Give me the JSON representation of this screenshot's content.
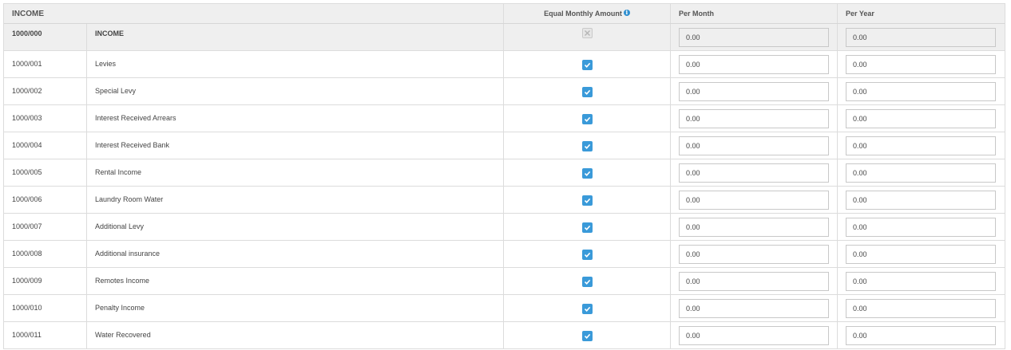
{
  "header": {
    "section": "INCOME",
    "equal_monthly": "Equal Monthly Amount",
    "per_month": "Per Month",
    "per_year": "Per Year"
  },
  "group": {
    "code": "1000/000",
    "name": "INCOME",
    "per_month": "0.00",
    "per_year": "0.00"
  },
  "rows": [
    {
      "code": "1000/001",
      "name": "Levies",
      "equal": true,
      "per_month": "0.00",
      "per_year": "0.00"
    },
    {
      "code": "1000/002",
      "name": "Special Levy",
      "equal": true,
      "per_month": "0.00",
      "per_year": "0.00"
    },
    {
      "code": "1000/003",
      "name": "Interest Received Arrears",
      "equal": true,
      "per_month": "0.00",
      "per_year": "0.00"
    },
    {
      "code": "1000/004",
      "name": "Interest Received Bank",
      "equal": true,
      "per_month": "0.00",
      "per_year": "0.00"
    },
    {
      "code": "1000/005",
      "name": "Rental Income",
      "equal": true,
      "per_month": "0.00",
      "per_year": "0.00"
    },
    {
      "code": "1000/006",
      "name": "Laundry Room Water",
      "equal": true,
      "per_month": "0.00",
      "per_year": "0.00"
    },
    {
      "code": "1000/007",
      "name": "Additional Levy",
      "equal": true,
      "per_month": "0.00",
      "per_year": "0.00"
    },
    {
      "code": "1000/008",
      "name": "Additional insurance",
      "equal": true,
      "per_month": "0.00",
      "per_year": "0.00"
    },
    {
      "code": "1000/009",
      "name": "Remotes Income",
      "equal": true,
      "per_month": "0.00",
      "per_year": "0.00"
    },
    {
      "code": "1000/010",
      "name": "Penalty Income",
      "equal": true,
      "per_month": "0.00",
      "per_year": "0.00"
    },
    {
      "code": "1000/011",
      "name": "Water Recovered",
      "equal": true,
      "per_month": "0.00",
      "per_year": "0.00"
    }
  ]
}
